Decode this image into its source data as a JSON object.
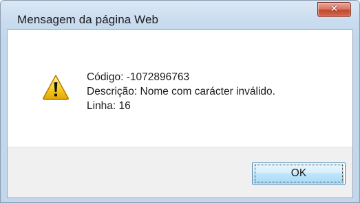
{
  "window": {
    "title": "Mensagem da página Web",
    "close_symbol": "✕"
  },
  "message": {
    "icon": "warning-icon",
    "lines": [
      "Código: -1072896763",
      "Descrição: Nome com carácter inválido.",
      "Linha: 16"
    ]
  },
  "buttons": {
    "ok_label": "OK"
  },
  "colors": {
    "warning_yellow": "#f5c400",
    "close_red": "#c2482f",
    "button_blue": "#3c7fb1"
  }
}
